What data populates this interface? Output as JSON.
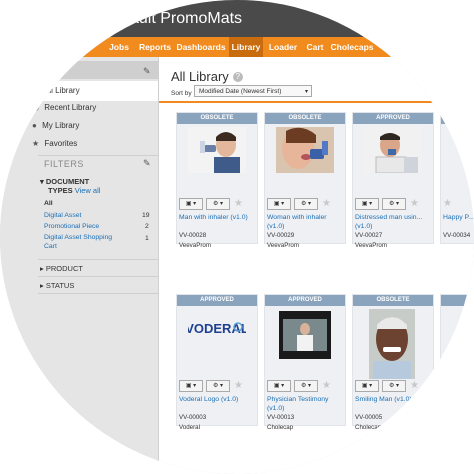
{
  "app": {
    "title": "ault PromoMats"
  },
  "nav": {
    "items": [
      "Jobs",
      "Reports",
      "Dashboards",
      "Library",
      "Loader",
      "Cart",
      "Cholecaps"
    ],
    "active": "Library"
  },
  "sidebar": {
    "items": [
      "All Library",
      "Recent Library",
      "My Library",
      "Favorites"
    ],
    "filters_label": "FILTERS",
    "document_types": {
      "label": "DOCUMENT TYPES",
      "label_line1": "DOCUMENT",
      "label_line2": "TYPES",
      "view_all": "View all",
      "entries": [
        {
          "label": "All",
          "count": ""
        },
        {
          "label": "Digital Asset",
          "count": "19"
        },
        {
          "label": "Promotional Piece",
          "count": "2"
        },
        {
          "label_line1": "Digital Asset Shopping",
          "label_line2": "Cart",
          "count": "1"
        }
      ]
    },
    "product_label": "PRODUCT",
    "status_label": "STATUS"
  },
  "main": {
    "title": "All Library",
    "sort_label": "Sort by",
    "sort_value": "Modified Date (Newest First)"
  },
  "cards": [
    {
      "status": "OBSOLETE",
      "title": "Man with inhaler (v1.0)",
      "id": "VV-00028",
      "owner": "VeevaProm"
    },
    {
      "status": "OBSOLETE",
      "title": "Woman with inhaler (v1.0)",
      "id": "VV-00029",
      "owner": "VeevaProm"
    },
    {
      "status": "APPROVED",
      "title": "Distressed man usin...(v1.0)",
      "id": "VV-00027",
      "owner": "VeevaProm"
    },
    {
      "status": "",
      "title": "Happy P...",
      "id": "VV-00034",
      "owner": ""
    },
    {
      "status": "APPROVED",
      "title": "Voderal Logo (v1.0)",
      "id": "VV-00003",
      "owner": "Voderal",
      "logo_text": "VODERAL"
    },
    {
      "status": "APPROVED",
      "title": "Physician Testimony (v1.0)",
      "id": "VV-00013",
      "owner": "Cholecap"
    },
    {
      "status": "OBSOLETE",
      "title": "Smiling Man (v1.0)",
      "id": "VV-00005",
      "owner": "Cholecap"
    },
    {
      "status": "",
      "title": "",
      "id": "",
      "owner": ""
    }
  ],
  "colors": {
    "accent": "#f18b1e",
    "badge": "#8ba4bd",
    "link": "#1a6fb5"
  }
}
